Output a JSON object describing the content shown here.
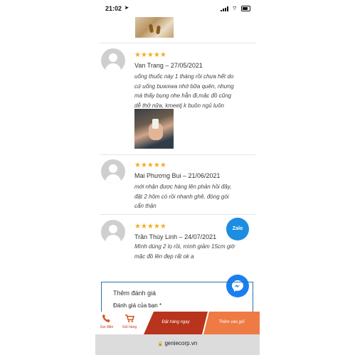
{
  "status_bar": {
    "time": "21:02",
    "location_glyph": "➤",
    "wifi_glyph": "⌔"
  },
  "reviews": [
    {
      "stars": "★★★★★",
      "author": "Van Trang",
      "date": "27/05/2021",
      "lines": [
        "uống thuốc này 1 tháng rồi chưa hết do",
        "cứ uống buwxwa nhớ bữa quên, nhưng",
        "mà thấy bụng nhe hẳn đi,mặc đồ cũng",
        "dễ thở nữa, kmeetj k buồn ngủ luôn"
      ]
    },
    {
      "stars": "★★★★★",
      "author": "Mai Phương Bui",
      "date": "21/06/2021",
      "lines": [
        "mới nhận được hàng lên phản hồi đây,",
        "đặt 2 hôm có rồi nhanh ghê, đóng gói",
        "cẩn thận"
      ]
    },
    {
      "stars": "★★★★★",
      "author": "Trần Thúy Linh",
      "date": "24/07/2021",
      "lines": [
        "Mình dùng 2 lọ rồi, mình giảm 15cm giờ",
        "mặc đồ lên đẹp rất ok ạ"
      ]
    }
  ],
  "form": {
    "title": "Thêm đánh giá",
    "rating_label": "Đánh giá của bạn *"
  },
  "floating": {
    "zalo_label": "Zalo"
  },
  "bottom_bar": {
    "call_label": "Gọi điện",
    "cart_label": "Giỏ hàng",
    "order_label": "Đặt hàng ngay",
    "add_to_cart_label": "Thêm vào giỏ"
  },
  "browser": {
    "url": "geniecorp.vn",
    "lock_glyph": "🔒"
  },
  "colors": {
    "star": "#f0ae22",
    "order_button": "#b8341c",
    "add_button": "#ee7a44",
    "zalo": "#1d8de2",
    "messenger": "#1a80f0"
  }
}
